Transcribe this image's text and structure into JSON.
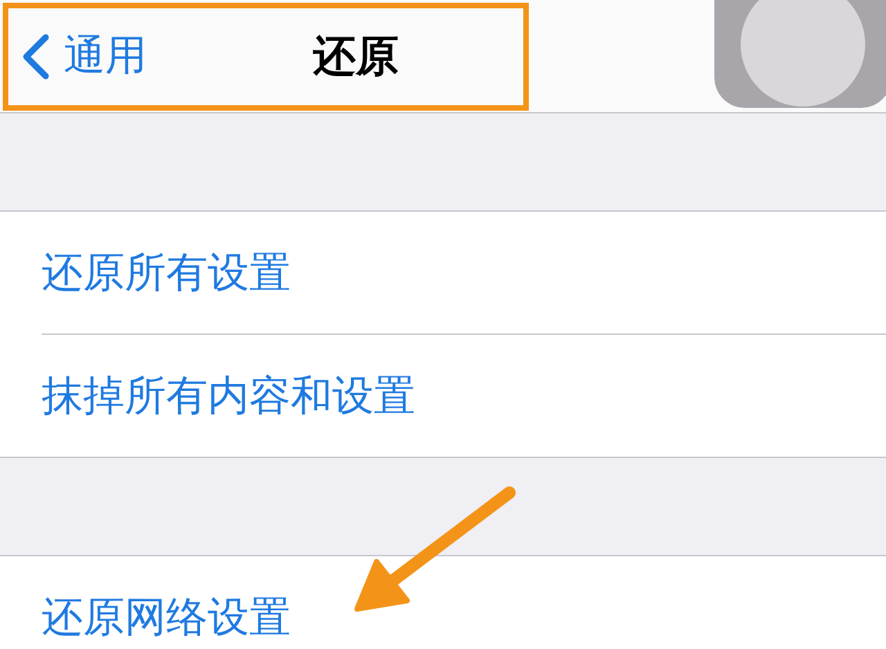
{
  "nav_bar": {
    "back_label": "通用",
    "title": "还原"
  },
  "groups": [
    {
      "items": [
        {
          "label": "还原所有设置"
        },
        {
          "label": "抹掉所有内容和设置"
        }
      ]
    },
    {
      "items": [
        {
          "label": "还原网络设置"
        }
      ]
    }
  ]
}
